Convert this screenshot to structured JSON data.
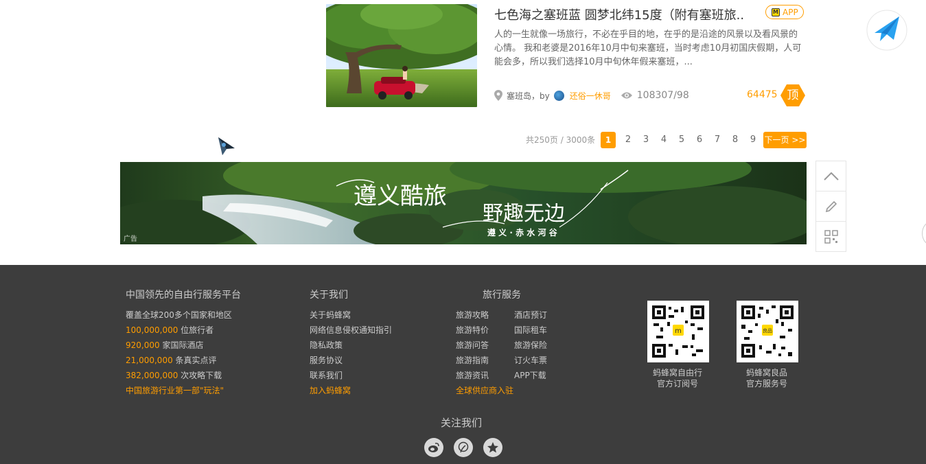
{
  "article": {
    "title": "七色海之塞班蓝 圆梦北纬15度（附有塞班旅..",
    "app_badge": "APP",
    "desc": "人的一生就像一场旅行，不必在乎目的地，在乎的是沿途的风景以及看风景的心情。 我和老婆是2016年10月中旬来塞班，当时考虑10月初国庆假期，人可能会多，所以我们选择10月中旬休年假来塞班，...",
    "location": "塞班岛",
    "by": "，by",
    "author": "还俗一休哥",
    "views": "108307/98",
    "likes": "64475",
    "top_label": "顶"
  },
  "pagination": {
    "info": "共250页 / 3000条",
    "pages": [
      "1",
      "2",
      "3",
      "4",
      "5",
      "6",
      "7",
      "8",
      "9"
    ],
    "current": "1",
    "next": "下一页 >>"
  },
  "banner": {
    "line1": "遵义酷旅",
    "line2": "野趣无边",
    "line3": "遵 义 · 赤 水 河 谷",
    "ad_label": "广告"
  },
  "footer": {
    "col1": {
      "title": "中国领先的自由行服务平台",
      "lines": [
        {
          "num": "",
          "text": "覆盖全球200多个国家和地区"
        },
        {
          "num": "100,000,000",
          "text": " 位旅行者"
        },
        {
          "num": "920,000",
          "text": " 家国际酒店"
        },
        {
          "num": "21,000,000",
          "text": " 条真实点评"
        },
        {
          "num": "382,000,000",
          "text": " 次攻略下载"
        }
      ],
      "highlight": "中国旅游行业第一部\"玩法\""
    },
    "col2": {
      "title": "关于我们",
      "links": [
        "关于蚂蜂窝",
        "网络信息侵权通知指引",
        "隐私政策",
        "服务协议",
        "联系我们"
      ],
      "highlight": "加入蚂蜂窝"
    },
    "col3": {
      "title": "旅行服务",
      "left": [
        "旅游攻略",
        "旅游特价",
        "旅游问答",
        "旅游指南",
        "旅游资讯"
      ],
      "right": [
        "酒店预订",
        "国际租车",
        "旅游保险",
        "订火车票",
        "APP下载"
      ],
      "highlight": "全球供应商入驻"
    },
    "qr1": {
      "line1": "蚂蜂窝自由行",
      "line2": "官方订阅号"
    },
    "qr2": {
      "line1": "蚂蜂窝良品",
      "line2": "官方服务号"
    },
    "follow_title": "关注我们"
  },
  "colors": {
    "accent": "#ff9d00",
    "footer_bg": "#3d3d3d"
  }
}
